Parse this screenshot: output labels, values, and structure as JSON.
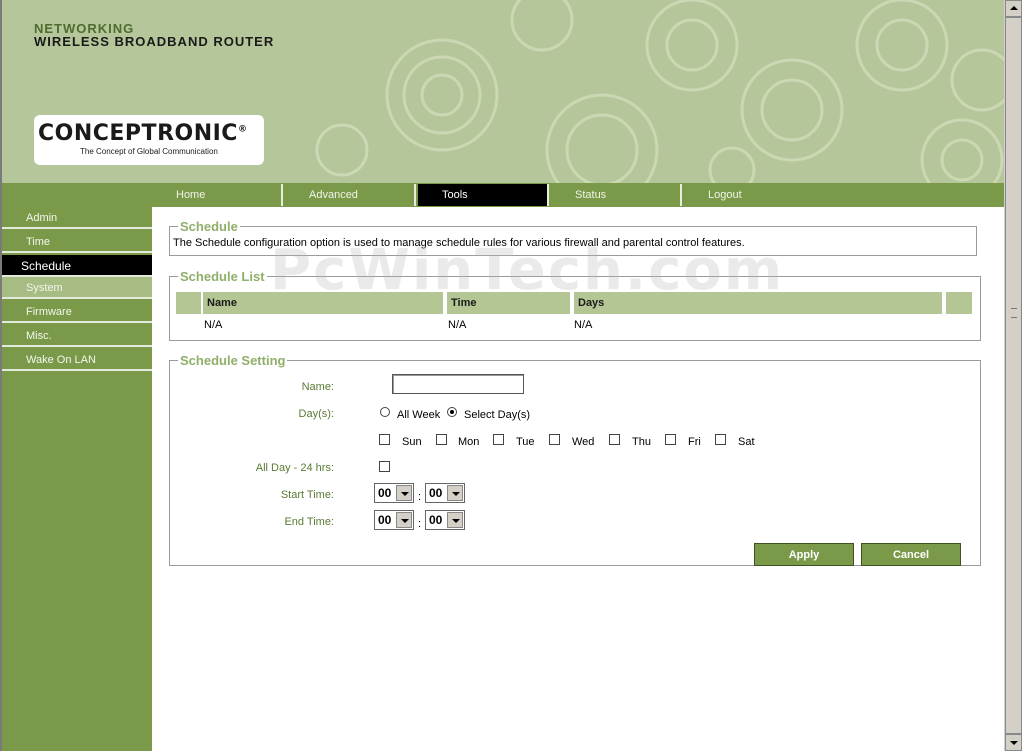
{
  "header": {
    "brand_line1": "NETWORKING",
    "brand_line2": "WIRELESS BROADBAND ROUTER",
    "logo_text": "CONCEPTRONIC",
    "logo_registered": "®",
    "logo_tagline": "The Concept of Global Communication"
  },
  "nav": {
    "tabs": [
      {
        "label": "Home"
      },
      {
        "label": "Advanced"
      },
      {
        "label": "Tools",
        "active": true
      },
      {
        "label": "Status"
      },
      {
        "label": "Logout"
      }
    ]
  },
  "sidebar": {
    "items": [
      {
        "label": "Admin"
      },
      {
        "label": "Time"
      },
      {
        "label": "Schedule",
        "active": true
      },
      {
        "label": "System"
      },
      {
        "label": "Firmware"
      },
      {
        "label": "Misc."
      },
      {
        "label": "Wake On LAN"
      }
    ]
  },
  "schedule": {
    "legend": "Schedule",
    "description": "The Schedule configuration option is used to manage schedule rules for various firewall and parental control features."
  },
  "schedule_list": {
    "legend": "Schedule List",
    "columns": [
      "Name",
      "Time",
      "Days"
    ],
    "rows": [
      {
        "name": "N/A",
        "time": "N/A",
        "days": "N/A"
      }
    ]
  },
  "schedule_setting": {
    "legend": "Schedule Setting",
    "name_label": "Name:",
    "name_value": "",
    "days_label": "Day(s):",
    "all_week_label": "All Week",
    "select_days_label": "Select Day(s)",
    "days_mode": "Select Day(s)",
    "day_names": [
      "Sun",
      "Mon",
      "Tue",
      "Wed",
      "Thu",
      "Fri",
      "Sat"
    ],
    "all_day_label": "All Day - 24 hrs:",
    "start_time_label": "Start Time:",
    "end_time_label": "End Time:",
    "start_hour": "00",
    "start_minute": "00",
    "end_hour": "00",
    "end_minute": "00",
    "time_separator": ":",
    "apply_label": "Apply",
    "cancel_label": "Cancel"
  },
  "watermark": "PcWinTech.com",
  "colors": {
    "header_bg": "#b5c79a",
    "nav_bg": "#7a9a4a",
    "accent_text": "#8faf6a",
    "table_header": "#b3c693",
    "active_bg": "#000000"
  }
}
